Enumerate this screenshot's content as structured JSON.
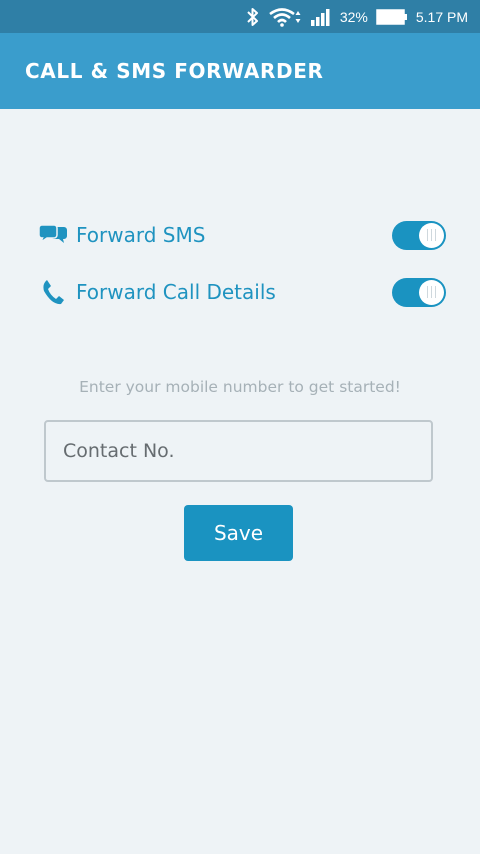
{
  "status_bar": {
    "battery_percent": "32%",
    "time": "5.17 PM",
    "icons": [
      "bluetooth-icon",
      "wifi-icon",
      "signal-icon",
      "battery-icon"
    ]
  },
  "app_bar": {
    "title": "CALL & SMS FORWARDER",
    "color": "#3a9dcc"
  },
  "settings": {
    "forward_sms": {
      "label": "Forward SMS",
      "icon": "chat-bubbles-icon",
      "enabled": true
    },
    "forward_call": {
      "label": "Forward Call Details",
      "icon": "phone-icon",
      "enabled": true
    }
  },
  "form": {
    "hint": "Enter your mobile number to get started!",
    "contact_placeholder": "Contact No.",
    "contact_value": "",
    "save_label": "Save"
  },
  "colors": {
    "accent": "#1a93c1",
    "background": "#eef3f6"
  }
}
